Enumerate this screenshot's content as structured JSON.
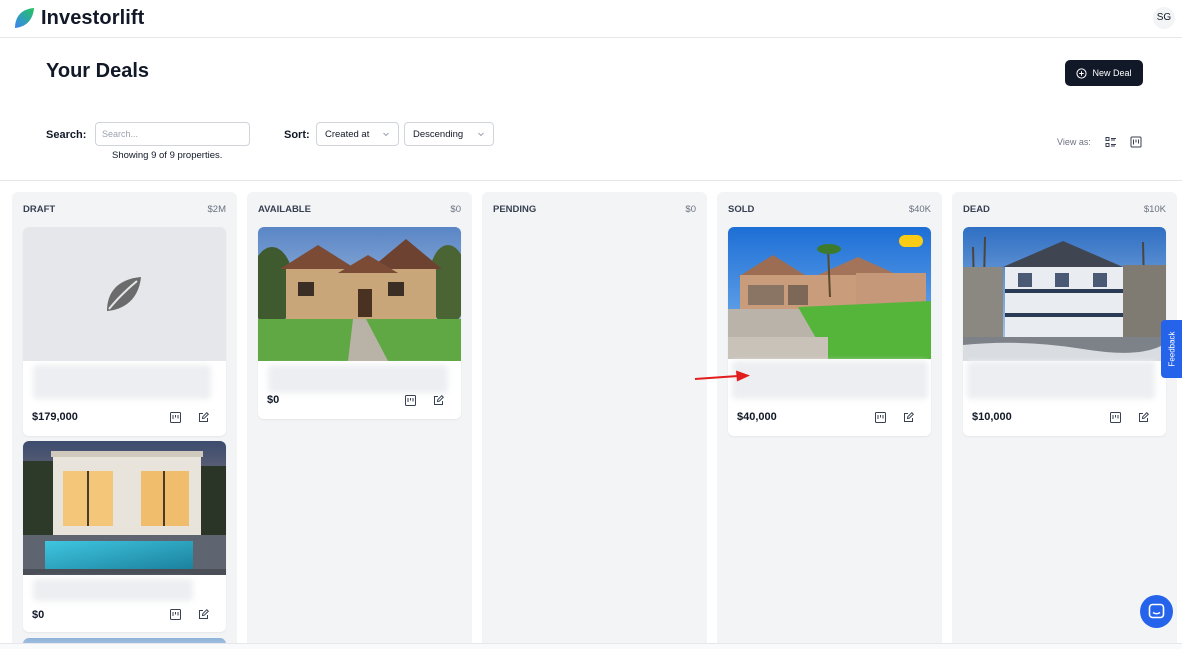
{
  "app": {
    "name": "Investorlift",
    "user_initials": "SG"
  },
  "header": {
    "title": "Your Deals",
    "new_deal_label": "New Deal"
  },
  "controls": {
    "search_label": "Search:",
    "search_placeholder": "Search...",
    "search_value": "",
    "showing_text": "Showing 9 of 9 properties.",
    "sort_label": "Sort:",
    "sort_field": "Created at",
    "sort_order": "Descending",
    "view_as_label": "View as:"
  },
  "columns": [
    {
      "title": "DRAFT",
      "total": "$2M",
      "cards": [
        {
          "price": "$179,000",
          "image": "placeholder-leaf"
        },
        {
          "price": "$0",
          "image": "modern-house-pool"
        }
      ]
    },
    {
      "title": "AVAILABLE",
      "total": "$0",
      "cards": [
        {
          "price": "$0",
          "image": "stone-house"
        }
      ]
    },
    {
      "title": "PENDING",
      "total": "$0",
      "cards": []
    },
    {
      "title": "SOLD",
      "total": "$40K",
      "cards": [
        {
          "price": "$40,000",
          "image": "stucco-house",
          "badge": "48%"
        }
      ]
    },
    {
      "title": "DEAD",
      "total": "$10K",
      "cards": [
        {
          "price": "$10,000",
          "image": "victorian-house"
        }
      ]
    }
  ],
  "widgets": {
    "feedback_label": "Feedback"
  },
  "colors": {
    "primary_dark": "#111827",
    "accent_blue": "#2563eb",
    "column_bg": "#f3f4f6",
    "arrow_red": "#e11d1d"
  }
}
